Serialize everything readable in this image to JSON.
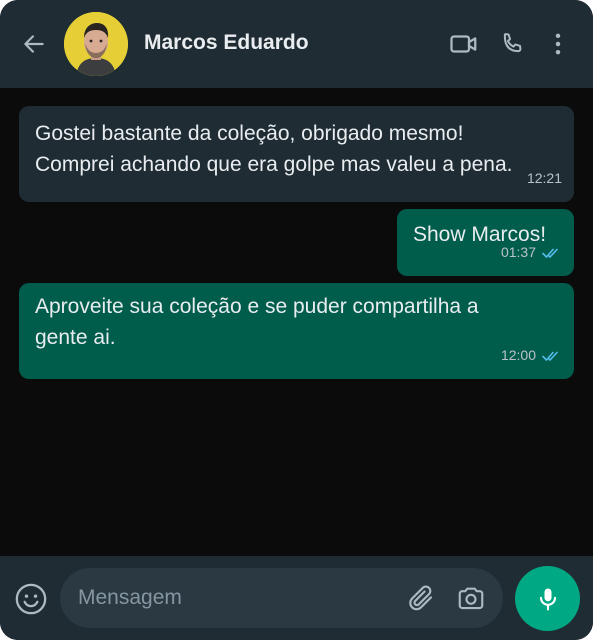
{
  "header": {
    "contact_name": "Marcos Eduardo",
    "icons": [
      "back-arrow-icon",
      "video-call-icon",
      "phone-icon",
      "more-vertical-icon"
    ]
  },
  "messages": [
    {
      "direction": "incoming",
      "text": "Gostei bastante da coleção, obrigado mesmo!\nComprei achando que era golpe mas valeu a pena.",
      "time": "12:21"
    },
    {
      "direction": "outgoing",
      "text": "Show Marcos!",
      "time": "01:37",
      "status": "read"
    },
    {
      "direction": "outgoing",
      "text": "Aproveite sua coleção e se puder compartilha a\ngente ai.",
      "time": "12:00",
      "status": "read"
    }
  ],
  "composer": {
    "placeholder": "Mensagem",
    "value": "",
    "icons": [
      "emoji-icon",
      "attach-icon",
      "camera-icon",
      "mic-icon"
    ]
  },
  "colors": {
    "header_bg": "#1f2c34",
    "chat_bg": "#0b0b0c",
    "incoming_bubble": "#1f2c34",
    "outgoing_bubble": "#005c4b",
    "read_tick": "#53bdeb",
    "accent": "#00a884"
  }
}
